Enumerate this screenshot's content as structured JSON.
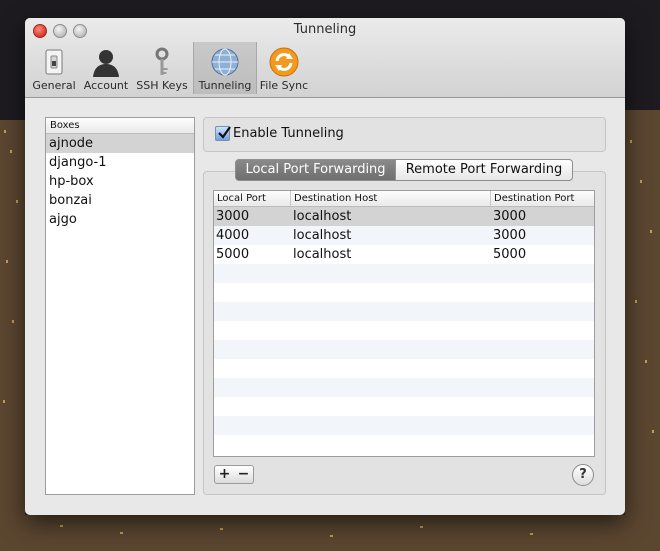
{
  "window": {
    "title": "Tunneling"
  },
  "toolbar": {
    "items": [
      {
        "label": "General",
        "icon": "switch-icon",
        "selected": false
      },
      {
        "label": "Account",
        "icon": "person-icon",
        "selected": false
      },
      {
        "label": "SSH Keys",
        "icon": "key-icon",
        "selected": false
      },
      {
        "label": "Tunneling",
        "icon": "globe-icon",
        "selected": true
      },
      {
        "label": "File Sync",
        "icon": "sync-icon",
        "selected": false
      }
    ]
  },
  "boxes": {
    "header": "Boxes",
    "items": [
      "ajnode",
      "django-1",
      "hp-box",
      "bonzai",
      "ajgo"
    ],
    "selected": "ajnode"
  },
  "tunneling": {
    "enable_label": "Enable Tunneling",
    "enabled": true
  },
  "tabs": {
    "local": "Local Port Forwarding",
    "remote": "Remote Port Forwarding",
    "active": "local"
  },
  "table": {
    "headers": [
      "Local Port",
      "Destination Host",
      "Destination Port"
    ],
    "rows": [
      [
        "3000",
        "localhost",
        "3000"
      ],
      [
        "4000",
        "localhost",
        "3000"
      ],
      [
        "5000",
        "localhost",
        "5000"
      ]
    ]
  },
  "buttons": {
    "add": "+",
    "remove": "−",
    "help": "?"
  },
  "colors": {
    "selection": "#d3d3d3",
    "active_tab": "#7a7a7a",
    "close_button": "#d8372c",
    "sync_orange": "#f29a1f"
  }
}
